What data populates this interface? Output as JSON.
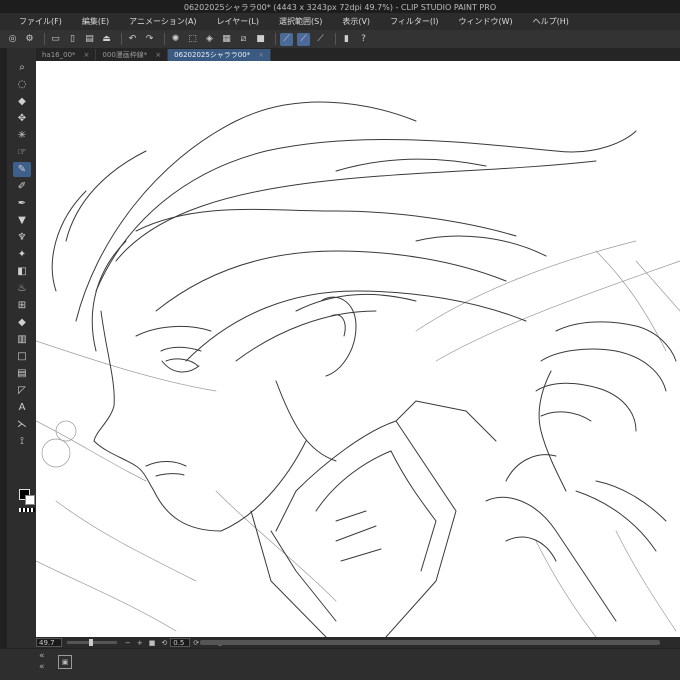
{
  "window": {
    "title": "06202025シャララ00* (4443 x 3243px 72dpi 49.7%)  - CLIP STUDIO PAINT PRO"
  },
  "menu": [
    "ファイル(F)",
    "編集(E)",
    "アニメーション(A)",
    "レイヤー(L)",
    "選択範囲(S)",
    "表示(V)",
    "フィルター(I)",
    "ウィンドウ(W)",
    "ヘルプ(H)"
  ],
  "tabs": [
    {
      "label": "ha16_00*",
      "active": false
    },
    {
      "label": "000漫画枠線*",
      "active": false
    },
    {
      "label": "06202025シャララ00*",
      "active": true
    }
  ],
  "status": {
    "zoom": "49.7",
    "rotation": "0.5"
  },
  "colors": {
    "main": "#000000",
    "sub": "#ffffff",
    "accent": "#3e5e8c"
  },
  "tool_icons": [
    "zoom-icon",
    "move-icon",
    "selection-icon",
    "object-icon",
    "auto-select-icon",
    "pen-icon",
    "pencil-icon",
    "brush-icon",
    "airbrush-icon",
    "decoration-icon",
    "eraser-icon",
    "blend-icon",
    "fill-icon",
    "gradient-icon",
    "figure-icon",
    "frame-icon",
    "ruler-icon",
    "text-icon",
    "balloon-icon",
    "correct-line-icon"
  ]
}
